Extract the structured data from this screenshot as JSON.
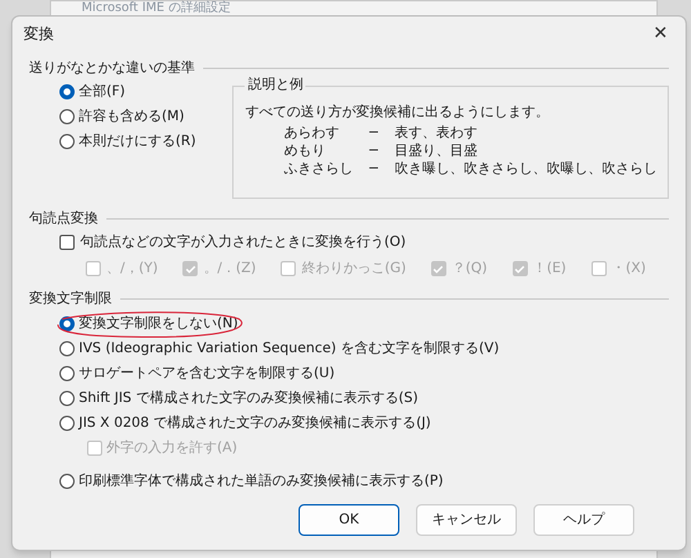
{
  "background_window": {
    "title": "Microsoft IME の詳細設定"
  },
  "dialog": {
    "title": "変換",
    "close": "✕"
  },
  "okurigana": {
    "title": "送りがなとかな違いの基準",
    "options": [
      {
        "label": "全部(F)",
        "selected": true
      },
      {
        "label": "許容も含める(M)",
        "selected": false
      },
      {
        "label": "本則だけにする(R)",
        "selected": false
      }
    ],
    "example": {
      "title": "説明と例",
      "description": "すべての送り方が変換候補に出るようにします。",
      "rows": [
        {
          "reading": "あらわす",
          "arrow": "─",
          "result": "表す、表わす"
        },
        {
          "reading": "めもり",
          "arrow": "─",
          "result": "目盛り、目盛"
        },
        {
          "reading": "ふきさらし",
          "arrow": "─",
          "result": "吹き曝し、吹きさらし、吹曝し、吹さらし"
        }
      ]
    }
  },
  "punctuation": {
    "title": "句読点変換",
    "main": {
      "label": "句読点などの文字が入力されたときに変換を行う(O)",
      "checked": false
    },
    "options": [
      {
        "label": "、/，(Y)",
        "checked": false,
        "disabled": true
      },
      {
        "label": "。/．(Z)",
        "checked": true,
        "disabled": true
      },
      {
        "label": "終わりかっこ(G)",
        "checked": false,
        "disabled": true
      },
      {
        "label": "？(Q)",
        "checked": true,
        "disabled": true
      },
      {
        "label": "！(E)",
        "checked": true,
        "disabled": true
      },
      {
        "label": "・(X)",
        "checked": false,
        "disabled": true
      }
    ]
  },
  "char_limit": {
    "title": "変換文字制限",
    "options": [
      {
        "kind": "radio",
        "label": "変換文字制限をしない(N)",
        "selected": true,
        "circled": true
      },
      {
        "kind": "radio",
        "label": "IVS (Ideographic Variation Sequence) を含む文字を制限する(V)",
        "selected": false
      },
      {
        "kind": "radio",
        "label": "サロゲートペアを含む文字を制限する(U)",
        "selected": false
      },
      {
        "kind": "radio",
        "label": "Shift JIS で構成された文字のみ変換候補に表示する(S)",
        "selected": false
      },
      {
        "kind": "radio",
        "label": "JIS X 0208 で構成された文字のみ変換候補に表示する(J)",
        "selected": false
      },
      {
        "kind": "checkbox",
        "label": "外字の入力を許す(A)",
        "checked": false,
        "disabled": true
      },
      {
        "kind": "radio",
        "label": "印刷標準字体で構成された単語のみ変換候補に表示する(P)",
        "selected": false
      }
    ]
  },
  "buttons": [
    {
      "label": "OK",
      "default": true
    },
    {
      "label": "キャンセル",
      "default": false
    },
    {
      "label": "ヘルプ",
      "default": false
    }
  ]
}
